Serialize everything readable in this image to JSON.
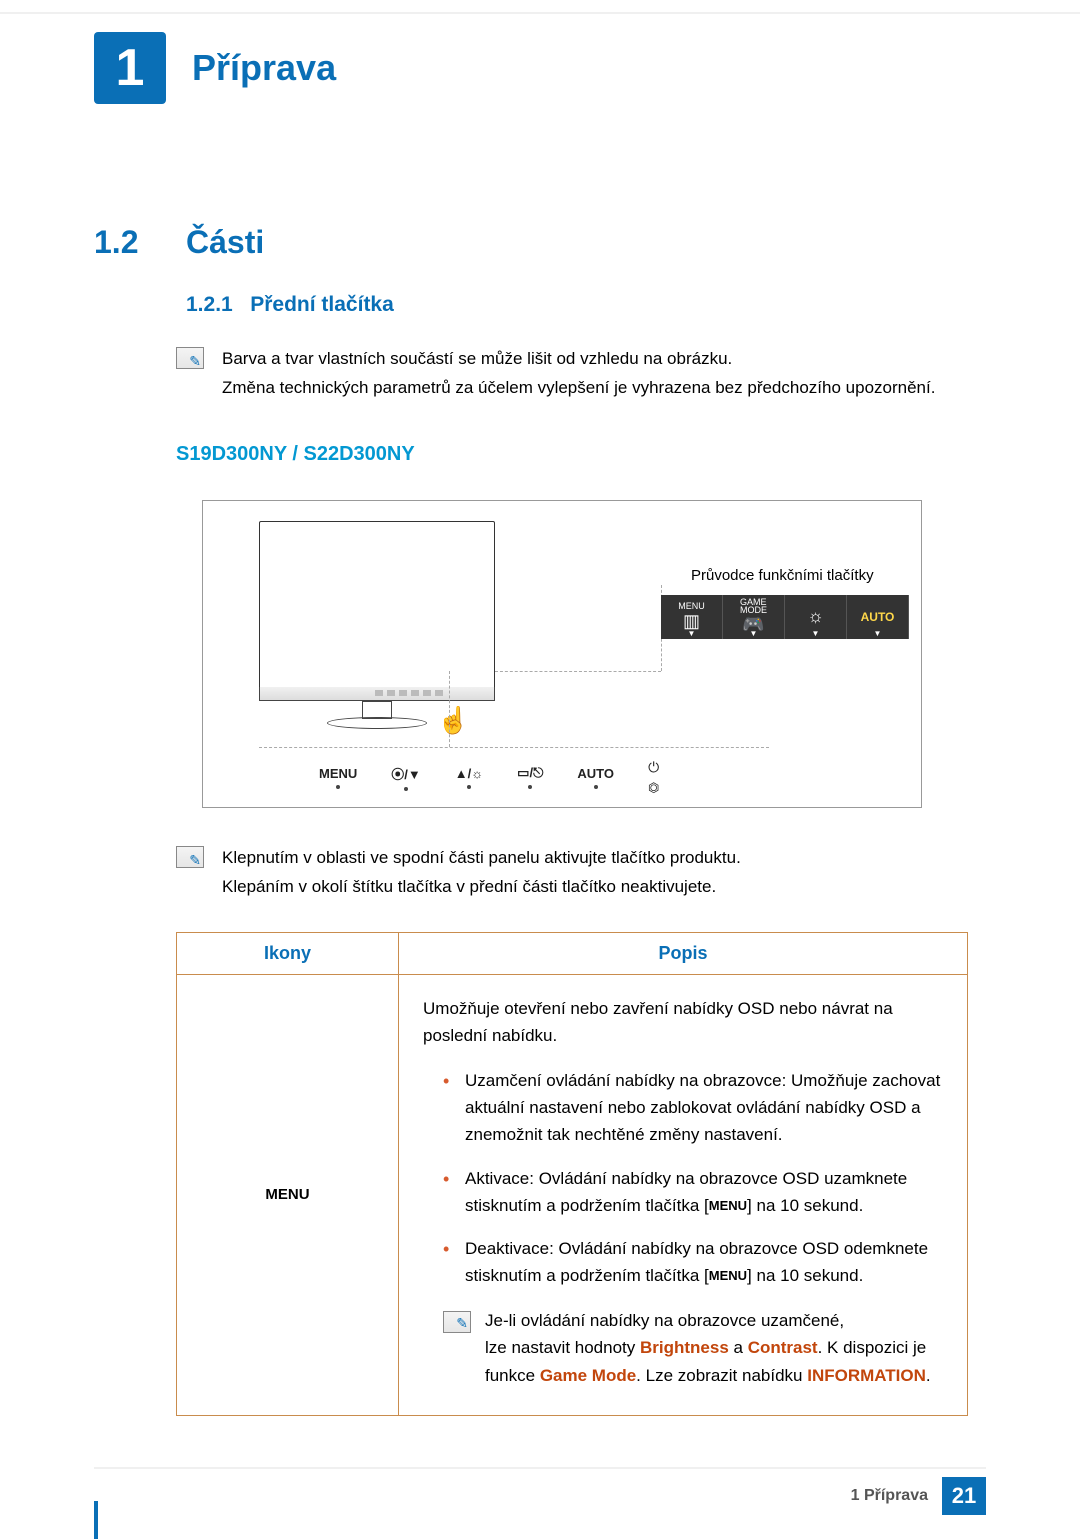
{
  "header": {
    "chapter_number": "1",
    "chapter_title": "Příprava"
  },
  "section": {
    "number": "1.2",
    "title": "Části"
  },
  "subsection": {
    "number": "1.2.1",
    "title": "Přední tlačítka"
  },
  "note1": {
    "line1": "Barva a tvar vlastních součástí se může lišit od vzhledu na obrázku.",
    "line2": "Změna technických parametrů za účelem vylepšení je vyhrazena bez předchozího upozornění."
  },
  "model_heading": "S19D300NY / S22D300NY",
  "diagram": {
    "callout_title": "Průvodce funkčními tlačítky",
    "osd_labels": {
      "menu": "MENU",
      "game_top": "GAME",
      "game_bot": "MODE",
      "auto": "AUTO"
    },
    "bottom_labels": {
      "menu": "MENU",
      "game": "⦿/▼",
      "up": "▲/☼",
      "source": "▭/⎋",
      "auto": "AUTO"
    }
  },
  "note2": {
    "line1": "Klepnutím v oblasti ve spodní části panelu aktivujte tlačítko produktu.",
    "line2": "Klepáním v okolí štítku tlačítka v přední části tlačítko neaktivujete."
  },
  "table": {
    "header_icons": "Ikony",
    "header_desc": "Popis",
    "row1_icon": "MENU",
    "row1": {
      "p1": "Umožňuje otevření nebo zavření nabídky OSD nebo návrat na poslední nabídku.",
      "b1": "Uzamčení ovládání nabídky na obrazovce: Umožňuje zachovat aktuální nastavení nebo zablokovat ovládání nabídky OSD a znemožnit tak nechtěné změny nastavení.",
      "b2a": "Aktivace: Ovládání nabídky na obrazovce OSD uzamknete stisknutím a podržením tlačítka [",
      "b2m": "MENU",
      "b2b": "] na 10 sekund.",
      "b3a": "Deaktivace: Ovládání nabídky na obrazovce OSD odemknete stisknutím a podržením tlačítka [",
      "b3m": "MENU",
      "b3b": "] na 10 sekund.",
      "sub1": "Je-li ovládání nabídky na obrazovce uzamčené,",
      "sub2a": "lze nastavit hodnoty ",
      "sub2b": "Brightness",
      "sub2c": " a ",
      "sub2d": "Contrast",
      "sub2e": ". K dispozici je funkce ",
      "sub2f": "Game Mode",
      "sub2g": ". Lze zobrazit nabídku ",
      "sub2h": "INFORMATION",
      "sub2i": "."
    }
  },
  "footer": {
    "text": "1 Příprava",
    "page": "21"
  }
}
